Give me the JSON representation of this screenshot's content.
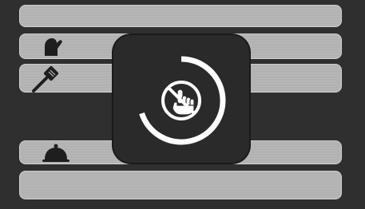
{
  "screen": {
    "rows": [
      {
        "name": "row-1",
        "icon": ""
      },
      {
        "name": "row-2",
        "icon": "oven-mitt-icon"
      },
      {
        "name": "row-3",
        "icon": "spatula-icon"
      },
      {
        "name": "row-4",
        "icon": "cloche-icon"
      },
      {
        "name": "row-5",
        "icon": ""
      }
    ]
  },
  "lock_overlay": {
    "icon": "no-touch-hand-icon",
    "progress": 0.7
  },
  "colors": {
    "background": "#2f2f2f",
    "row": "#b9b9b9",
    "overlay": "#2a2a2a",
    "ring": "#ffffff"
  }
}
